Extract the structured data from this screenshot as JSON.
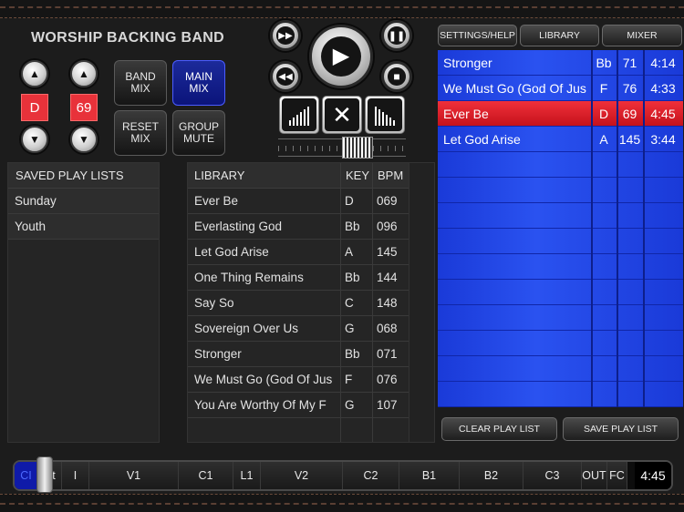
{
  "app": {
    "title": "WORSHIP BACKING BAND"
  },
  "controls": {
    "key_value": "D",
    "tempo_value": "69",
    "band_mix": "BAND MIX",
    "main_mix": "MAIN MIX",
    "reset_mix": "RESET MIX",
    "group_mute": "GROUP MUTE"
  },
  "top_buttons": {
    "settings": "SETTINGS/HELP",
    "library": "LIBRARY",
    "mixer": "MIXER"
  },
  "saved_playlists": {
    "header": "SAVED PLAY LISTS",
    "items": [
      "Sunday",
      "Youth"
    ]
  },
  "library": {
    "headers": {
      "title": "LIBRARY",
      "key": "KEY",
      "bpm": "BPM"
    },
    "rows": [
      {
        "title": "Ever Be",
        "key": "D",
        "bpm": "069"
      },
      {
        "title": "Everlasting God",
        "key": "Bb",
        "bpm": "096"
      },
      {
        "title": "Let God Arise",
        "key": "A",
        "bpm": "145"
      },
      {
        "title": "One Thing Remains",
        "key": "Bb",
        "bpm": "144"
      },
      {
        "title": "Say So",
        "key": "C",
        "bpm": "148"
      },
      {
        "title": "Sovereign Over Us",
        "key": "G",
        "bpm": "068"
      },
      {
        "title": "Stronger",
        "key": "Bb",
        "bpm": "071"
      },
      {
        "title": "We Must Go (God Of Jus",
        "key": "F",
        "bpm": "076"
      },
      {
        "title": "You Are Worthy Of My F",
        "key": "G",
        "bpm": "107"
      }
    ]
  },
  "playlist": {
    "rows": [
      {
        "title": "Stronger",
        "key": "Bb",
        "bpm": "71",
        "length": "4:14"
      },
      {
        "title": "We Must Go (God Of Jus",
        "key": "F",
        "bpm": "76",
        "length": "4:33"
      },
      {
        "title": "Ever Be",
        "key": "D",
        "bpm": "69",
        "length": "4:45"
      },
      {
        "title": "Let God Arise",
        "key": "A",
        "bpm": "145",
        "length": "3:44"
      }
    ],
    "playing_index": 2,
    "clear_label": "CLEAR PLAY LIST",
    "save_label": "SAVE PLAY LIST"
  },
  "timeline": {
    "sections": [
      "CI",
      "Ct",
      "I",
      "V1",
      "C1",
      "L1",
      "V2",
      "C2",
      "B1",
      "B2",
      "C3",
      "OUT",
      "FC"
    ],
    "time": "4:45"
  },
  "colors": {
    "accent_blue": "#2a52f0",
    "playing_red": "#e8323a",
    "active_button": "#1c2a9a"
  }
}
